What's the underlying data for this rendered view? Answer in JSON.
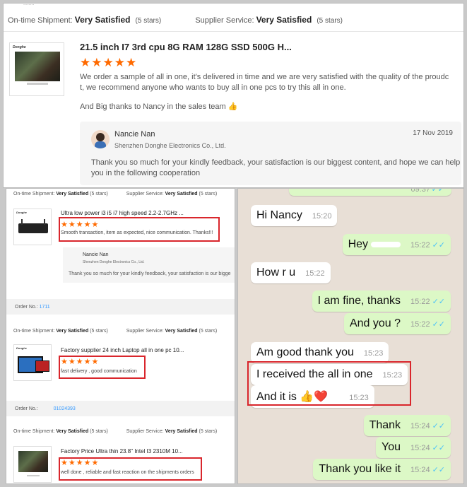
{
  "top_review": {
    "cut_text": "........",
    "shipment_label": "On-time Shipment:",
    "shipment_value": "Very Satisfied",
    "shipment_stars": "(5 stars)",
    "supplier_label": "Supplier Service:",
    "supplier_value": "Very Satisfied",
    "supplier_stars": "(5 stars)",
    "thumb_brand": "Donghe",
    "product_title": "21.5 inch I7 3rd cpu 8G RAM 128G SSD 500G H...",
    "rating": 5,
    "stars": "★★★★★",
    "review_line1": "We order a sample of all in one, it's delivered in time and we are very satisfied with the quality of the proudc",
    "review_line2": "t, we recommend anyone who wants to buy all in one pcs to try this all in one.",
    "review_line3": "And Big thanks to Nancy in the sales team 👍",
    "reply_name": "Nancie Nan",
    "reply_company": "Shenzhen Donghe Electronics Co., Ltd.",
    "reply_date": "17 Nov 2019",
    "reply_line1": "Thank you so much for your kindly feedback, your satisfaction is our biggest content, and hope we can help",
    "reply_line2": "you in the following cooperation"
  },
  "left_reviews": {
    "r1": {
      "shipment_label": "On-time Shipment:",
      "shipment_value": "Very Satisfied",
      "shipment_stars": "(5 stars)",
      "supplier_label": "Supplier Service:",
      "supplier_value": "Very Satisfied",
      "supplier_stars": "(5 stars)",
      "thumb_brand": "Donghe",
      "product_title": "Ultra low power i3 i5 i7 high speed 2.2-2.7GHz ...",
      "stars": "★★★★★",
      "text": "Smooth transaction, item as expected, nice communication. Thanks!!!",
      "reply_name": "Nancie Nan",
      "reply_company": "Shenzhen Donghe Electronics Co., Ltd.",
      "reply_text": "Thank you so much for your kindly feedback, your satisfaction is our bigge"
    },
    "order1_label": "Order No.:",
    "order1_value": "1711",
    "r2": {
      "shipment_label": "On-time Shipment:",
      "shipment_value": "Very Satisfied",
      "shipment_stars": "(5 stars)",
      "supplier_label": "Supplier Service:",
      "supplier_value": "Very Satisfied",
      "supplier_stars": "(5 stars)",
      "thumb_brand": "Donghe",
      "product_title": "Factory supplier 24 inch Laptop all in one pc 10...",
      "stars": "★★★★★",
      "text": "fast delivery , good communication"
    },
    "order2_label": "Order No.:",
    "order2_value": "01024393",
    "r3": {
      "shipment_label": "On-time Shipment:",
      "shipment_value": "Very Satisfied",
      "shipment_stars": "(5 stars)",
      "supplier_label": "Supplier Service:",
      "supplier_value": "Very Satisfied",
      "supplier_stars": "(5 stars)",
      "product_title": "Factory Price Ultra thin 23.8\" Intel I3 2310M 10...",
      "stars": "★★★★★",
      "text": "well done , reliable and fast reaction on the shipments orders"
    }
  },
  "chat": {
    "top_time": "09:37",
    "tick": "✓✓",
    "messages": [
      {
        "text": "Hi Nancy",
        "time": "15:20"
      },
      {
        "text": "Hey",
        "time": "15:22"
      },
      {
        "text": "How r u",
        "time": "15:22"
      },
      {
        "text": "I am fine, thanks",
        "time": "15:22"
      },
      {
        "text": "And you ?",
        "time": "15:22"
      },
      {
        "text": "Am good thank you",
        "time": "15:23"
      },
      {
        "text": "I received the all in one",
        "time": "15:23"
      },
      {
        "text": "And it is 👍❤️",
        "time": "15:23"
      },
      {
        "text": "Thank",
        "time": "15:24"
      },
      {
        "text": "You",
        "time": "15:24"
      },
      {
        "text": "Thank you like it",
        "time": "15:24"
      }
    ]
  },
  "colors": {
    "star": "#ff6a00",
    "highlight_box": "#d9262c",
    "outgoing": "#dcf8c6",
    "link": "#3399ff"
  }
}
